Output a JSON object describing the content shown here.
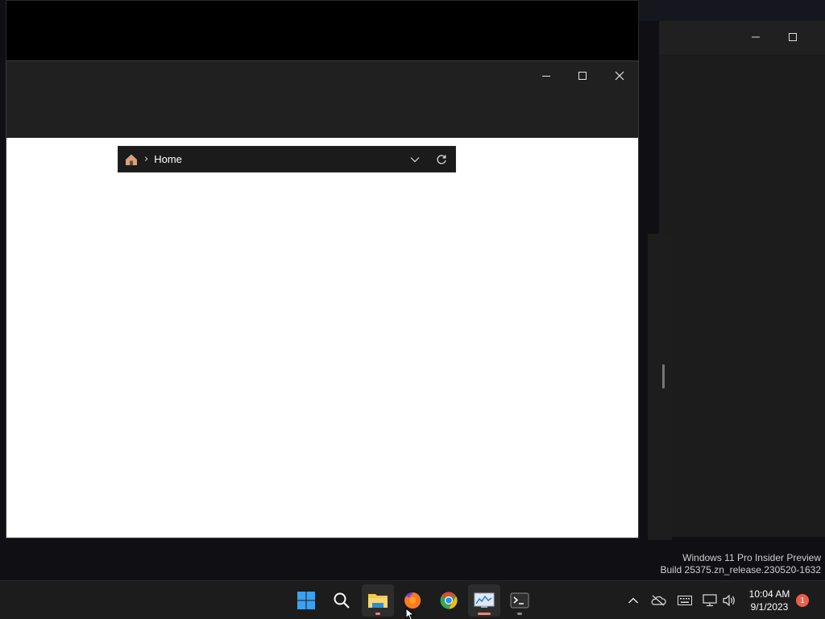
{
  "explorer": {
    "breadcrumb": {
      "items": [
        "Home"
      ]
    }
  },
  "desktop": {
    "watermark_line1": "Windows 11 Pro Insider Preview",
    "watermark_line2": "Build 25375.zn_release.230520-1632"
  },
  "taskbar": {
    "apps": [
      {
        "name": "Start",
        "icon": "windows-logo-icon"
      },
      {
        "name": "Search",
        "icon": "search-icon"
      },
      {
        "name": "File Explorer",
        "icon": "folder-icon",
        "state": "active"
      },
      {
        "name": "Firefox",
        "icon": "firefox-icon"
      },
      {
        "name": "Chrome",
        "icon": "chrome-icon"
      },
      {
        "name": "Performance Monitor",
        "icon": "monitor-chart-icon",
        "state": "focused"
      },
      {
        "name": "Terminal",
        "icon": "terminal-icon",
        "state": "running"
      }
    ],
    "tray": {
      "icons": [
        "chevron-up-icon",
        "onedrive-icon",
        "keyboard-icon",
        "network-icon",
        "volume-icon"
      ],
      "time": "10:04 AM",
      "date": "9/1/2023",
      "notification_count": "1"
    }
  },
  "colors": {
    "titlebar": "#202020",
    "addressbar": "#1b1b1b",
    "taskbar": "#1c1c1c",
    "accent_indicator": "#e48a7a",
    "badge": "#e8604c"
  }
}
